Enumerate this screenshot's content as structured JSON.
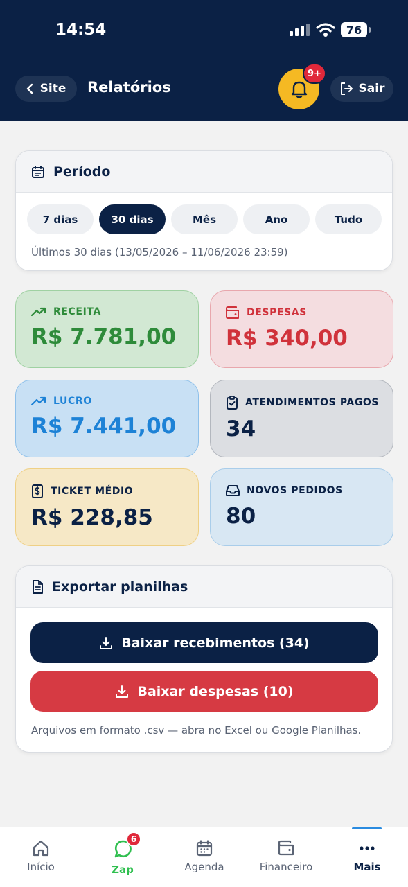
{
  "status_bar": {
    "time": "14:54",
    "battery": "76"
  },
  "header": {
    "back_label": "Site",
    "title": "Relatórios",
    "notification_badge": "9+",
    "logout_label": "Sair"
  },
  "period": {
    "title": "Período",
    "options": [
      "7 dias",
      "30 dias",
      "Mês",
      "Ano",
      "Tudo"
    ],
    "selected": "30 dias",
    "summary": "Últimos 30 dias (13/05/2026 – 11/06/2026 23:59)"
  },
  "stats": {
    "receita": {
      "label": "RECEITA",
      "value": "R$ 7.781,00"
    },
    "despesas": {
      "label": "DESPESAS",
      "value": "R$ 340,00"
    },
    "lucro": {
      "label": "LUCRO",
      "value": "R$ 7.441,00"
    },
    "atendimentos": {
      "label": "ATENDIMENTOS PAGOS",
      "value": "34"
    },
    "ticket": {
      "label": "TICKET MÉDIO",
      "value": "R$ 228,85"
    },
    "pedidos": {
      "label": "NOVOS PEDIDOS",
      "value": "80"
    }
  },
  "export": {
    "title": "Exportar planilhas",
    "download_receipts": "Baixar recebimentos (34)",
    "download_expenses": "Baixar despesas (10)",
    "note": "Arquivos em formato .csv — abra no Excel ou Google Planilhas."
  },
  "nav": {
    "items": [
      {
        "label": "Início",
        "icon": "home-icon"
      },
      {
        "label": "Zap",
        "icon": "whatsapp-icon",
        "badge": "6"
      },
      {
        "label": "Agenda",
        "icon": "calendar-icon"
      },
      {
        "label": "Financeiro",
        "icon": "wallet-icon"
      },
      {
        "label": "Mais",
        "icon": "more-icon"
      }
    ],
    "active": "Mais"
  },
  "colors": {
    "primary": "#0b2145",
    "accent_yellow": "#f5b923",
    "danger": "#d63a43",
    "green": "#2e8b3a",
    "blue": "#1d82d6"
  }
}
